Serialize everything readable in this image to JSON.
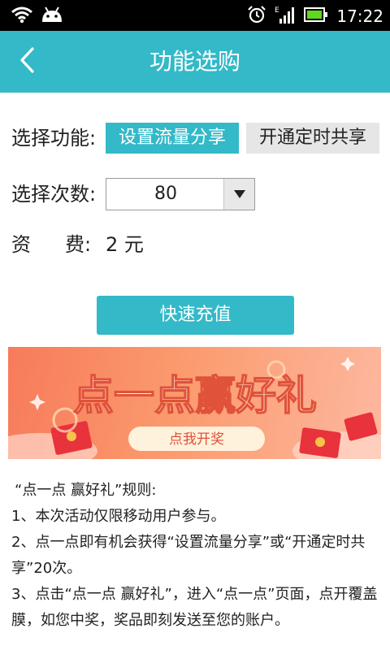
{
  "status_bar": {
    "time": "17:22"
  },
  "header": {
    "title": "功能选购"
  },
  "form": {
    "function_label": "选择功能:",
    "options": [
      "设置流量分享",
      "开通定时共享"
    ],
    "selected_option": "设置流量分享",
    "count_label": "选择次数:",
    "count_value": "80",
    "fee_label_1": "资",
    "fee_label_2": "费:",
    "fee_value": "2 元"
  },
  "charge_button": "快速充值",
  "banner": {
    "headline": "点一点赢好礼",
    "button": "点我开奖"
  },
  "rules": {
    "title": "“点一点 赢好礼”规则:",
    "items": [
      "1、本次活动仅限移动用户参与。",
      "2、点一点即有机会获得“设置流量分享”或“开通定时共享”20次。",
      "3、点击“点一点 赢好礼”，进入“点一点”页面，点开覆盖膜，如您中奖，奖品即刻发送至您的账户。"
    ]
  },
  "colors": {
    "accent": "#33b9c8",
    "status_bar": "#000000",
    "banner_bg": "#f88a62"
  },
  "icons": [
    "wifi-icon",
    "android-icon",
    "alarm-icon",
    "signal-icon",
    "battery-icon",
    "back-arrow-icon",
    "dropdown-arrow-icon"
  ]
}
